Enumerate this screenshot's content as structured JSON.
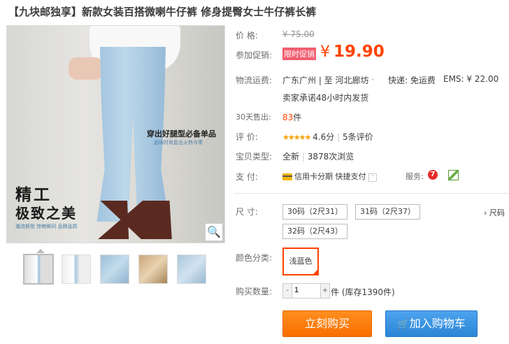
{
  "title": "【九块邮独享】新款女装百搭微喇牛仔裤 修身提臀女士牛仔裤长裤",
  "image": {
    "promo_line1": "穿出好腿型必备单品",
    "promo_line2": "品味时尚复出火热今季",
    "big_text1": "精工",
    "big_text2": "极致之美",
    "tags": "潮流裤型   惊艳瞬间   品牌品质",
    "zoom_icon": "🔍"
  },
  "price": {
    "label": "价     格:",
    "original": "¥ 75.00",
    "promo_label": "参加促销:",
    "promo_badge": "限时促销",
    "currency": "¥",
    "current": "19.90"
  },
  "shipping": {
    "label": "物流运费:",
    "from": "广东广州 | 至  河北廊坊",
    "express": "快递: 免运费",
    "ems": "EMS: ¥ 22.00",
    "promise": "卖家承诺48小时内发货"
  },
  "sales": {
    "label": "30天售出:",
    "count": "83",
    "unit": "件"
  },
  "rating": {
    "label": "评     价:",
    "stars": "★★★★★",
    "score": "4.6分",
    "reviews": "5条评价"
  },
  "item_type": {
    "label": "宝贝类型:",
    "condition": "全新",
    "views": "3878次浏览"
  },
  "payment": {
    "label": "支     付:",
    "credit": "信用卡分期",
    "quick": "快捷支付",
    "service_label": "服务:"
  },
  "size": {
    "label": "尺     寸:",
    "options": [
      "30码（2尺31）",
      "31码（2尺37）",
      "32码（2尺43）"
    ],
    "chart_link": "› 尺码"
  },
  "color": {
    "label": "颜色分类:",
    "selected": "浅蓝色"
  },
  "quantity": {
    "label": "购买数量:",
    "minus": "-",
    "value": "1",
    "plus": "+",
    "unit_stock": "件 (库存1390件)"
  },
  "buttons": {
    "buy": "立刻购买",
    "cart": "加入购物车"
  }
}
